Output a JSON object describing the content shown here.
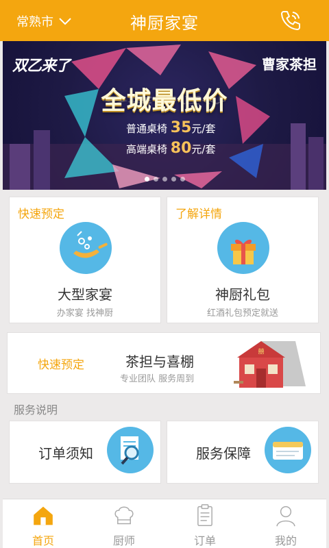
{
  "header": {
    "city": "常熟市",
    "title": "神厨家宴",
    "phone_icon": "phone-icon"
  },
  "banner": {
    "brand_left": "双乙来了",
    "brand_right": "曹家茶担",
    "headline": "全城最低价",
    "price_lines": [
      {
        "prefix": "普通桌椅",
        "value": "35",
        "unit": "元/套"
      },
      {
        "prefix": "高端桌椅",
        "value": "80",
        "unit": "元/套"
      }
    ],
    "slide_count": 5,
    "active_slide": 1
  },
  "cards": {
    "banquet": {
      "tag": "快速预定",
      "title": "大型家宴",
      "subtitle": "办家宴 找神厨",
      "icon": "cooking-pan-icon"
    },
    "gift": {
      "tag": "了解详情",
      "title": "神厨礼包",
      "subtitle": "红酒礼包预定就送",
      "icon": "gift-box-icon"
    },
    "tent": {
      "tag": "快速预定",
      "title": "茶担与喜棚",
      "subtitle": "专业团队 服务周到",
      "icon": "wedding-tent-icon"
    }
  },
  "services": {
    "label": "服务说明",
    "items": [
      {
        "title": "订单须知",
        "icon": "magnifier-document-icon"
      },
      {
        "title": "服务保障",
        "icon": "rated-card-icon"
      }
    ]
  },
  "tabbar": {
    "items": [
      {
        "label": "首页",
        "icon": "home-icon",
        "active": true
      },
      {
        "label": "厨师",
        "icon": "chef-hat-icon",
        "active": false
      },
      {
        "label": "订单",
        "icon": "order-list-icon",
        "active": false
      },
      {
        "label": "我的",
        "icon": "user-icon",
        "active": false
      }
    ]
  },
  "colors": {
    "accent": "#f4a60f",
    "icon_blue": "#55b8e6"
  }
}
